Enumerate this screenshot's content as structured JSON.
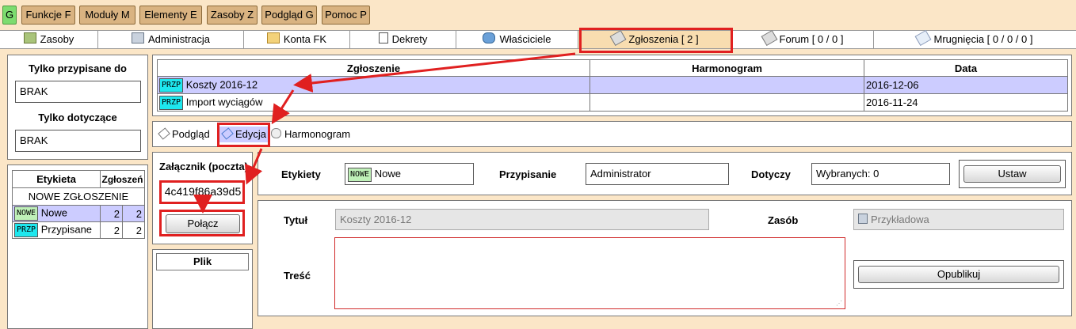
{
  "menu": {
    "home": "G",
    "items": [
      "Funkcje F",
      "Moduły M",
      "Elementy E",
      "Zasoby Z",
      "Podgląd G",
      "Pomoc P"
    ]
  },
  "tabs": [
    "Zasoby",
    "Administracja",
    "Konta FK",
    "Dekrety",
    "Właściciele",
    "Zgłoszenia [ 2 ]",
    "Forum [ 0 / 0 ]",
    "Mrugnięcia [ 0 / 0 / 0 ]"
  ],
  "left": {
    "assigned_title": "Tylko przypisane do",
    "assigned_value": "BRAK",
    "concerning_title": "Tylko dotyczące",
    "concerning_value": "BRAK",
    "labels_table": {
      "headers": [
        "Etykieta",
        "Zgłoszeń"
      ],
      "group_row": "NOWE ZGŁOSZENIE",
      "rows": [
        {
          "tag": "NOWE",
          "name": "Nowe",
          "a": "2",
          "b": "2"
        },
        {
          "tag": "PRZP",
          "name": "Przypisane",
          "a": "2",
          "b": "2"
        }
      ]
    }
  },
  "tickets": {
    "headers": [
      "Zgłoszenie",
      "Harmonogram",
      "Data"
    ],
    "rows": [
      {
        "tag": "PRZP",
        "title": "Koszty 2016-12",
        "schedule": "",
        "date": "2016-12-06"
      },
      {
        "tag": "PRZP",
        "title": "Import wyciągów",
        "schedule": "",
        "date": "2016-11-24"
      }
    ]
  },
  "subtabs": [
    "Podgląd",
    "Edycja",
    "Harmonogram"
  ],
  "attachment": {
    "title": "Załącznik (poczta)",
    "code": "4c419f86a39d5",
    "connect": "Połącz",
    "file_header": "Plik"
  },
  "edit": {
    "labels_label": "Etykiety",
    "labels_tag": "NOWE",
    "labels_value": "Nowe",
    "assign_label": "Przypisanie",
    "assign_value": "Administrator",
    "concerns_label": "Dotyczy",
    "concerns_value": "Wybranych: 0",
    "set_button": "Ustaw",
    "title_label": "Tytuł",
    "title_value": "Koszty 2016-12",
    "resource_label": "Zasób",
    "resource_value": "Przykładowa",
    "content_label": "Treść",
    "publish_button": "Opublikuj"
  },
  "colors": {
    "highlight": "#e02020",
    "selected_row": "#ccccff",
    "background": "#fbe6c7"
  }
}
